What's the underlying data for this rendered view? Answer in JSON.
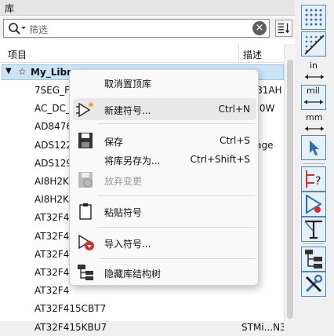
{
  "panel": {
    "title": "库",
    "filter_placeholder": "筛选",
    "clear_glyph": "×",
    "columns": {
      "item": "项目",
      "desc": "描述"
    }
  },
  "library": {
    "name": "My_Libr",
    "expand_glyph": "▼",
    "star_glyph": "☆"
  },
  "rows": [
    {
      "name": "7SEG_F",
      "desc": "...381AH"
    },
    {
      "name": "AC_DC_",
      "desc": "... 10W"
    },
    {
      "name": "AD8476",
      "desc": ""
    },
    {
      "name": "ADS122",
      "desc": "...kage"
    },
    {
      "name": "ADS129",
      "desc": ""
    },
    {
      "name": "AI8H2K",
      "desc": ""
    },
    {
      "name": "AI8H2K",
      "desc": ""
    },
    {
      "name": "AT32F4",
      "desc": ""
    },
    {
      "name": "AT32F4",
      "desc": ""
    },
    {
      "name": "AT32F4",
      "desc": ""
    },
    {
      "name": "AT32F4",
      "desc": ""
    },
    {
      "name": "AT32F4",
      "desc": ""
    },
    {
      "name": "AT32F415CBT7",
      "desc": ""
    },
    {
      "name": "AT32F415KBU7",
      "desc": "STMi...N32"
    }
  ],
  "menu": {
    "unpin": "取消置顶库",
    "new_symbol": "新建符号...",
    "new_symbol_sc": "Ctrl+N",
    "save": "保存",
    "save_sc": "Ctrl+S",
    "save_as": "将库另存为...",
    "save_as_sc": "Ctrl+Shift+S",
    "revert": "放弃变更",
    "paste": "粘贴符号",
    "import": "导入符号...",
    "hide_tree": "隐藏库结构树"
  },
  "toolbar": {
    "units_in": "in",
    "units_mil": "mil",
    "units_mm": "mm"
  },
  "colors": {
    "accent": "#2f6db5",
    "selection": "#cce4f7"
  }
}
